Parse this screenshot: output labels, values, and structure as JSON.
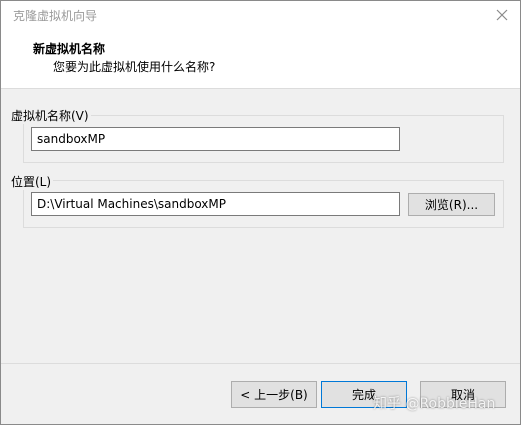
{
  "window": {
    "title": "克隆虚拟机向导",
    "close_icon": "close-icon"
  },
  "header": {
    "title": "新虚拟机名称",
    "subtitle": "您要为此虚拟机使用什么名称?"
  },
  "name_group": {
    "label": "虚拟机名称(V)",
    "value": "sandboxMP"
  },
  "location_group": {
    "label": "位置(L)",
    "value": "D:\\Virtual Machines\\sandboxMP",
    "browse_label": "浏览(R)..."
  },
  "footer": {
    "back_label": "< 上一步(B)",
    "finish_label": "完成",
    "cancel_label": "取消"
  },
  "watermark": "知乎 @RobbieHan",
  "colors": {
    "dialog_bg": "#f0f0f0",
    "header_bg": "#ffffff",
    "default_button_border": "#0078d7"
  }
}
